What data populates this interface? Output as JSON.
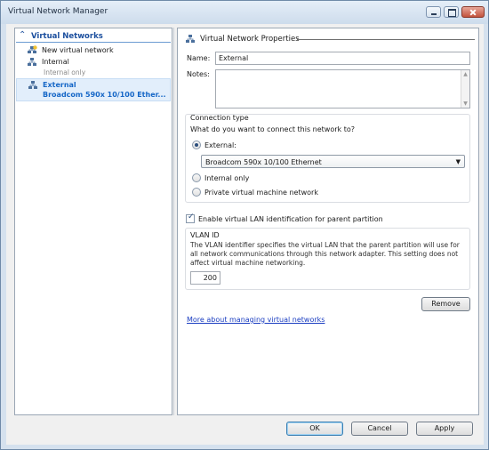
{
  "window": {
    "title": "Virtual Network Manager"
  },
  "tree": {
    "header": "Virtual Networks",
    "items": [
      {
        "label": "New virtual network",
        "icon": "new-network-icon"
      },
      {
        "label": "Internal",
        "sublabel": "Internal only",
        "icon": "network-icon"
      },
      {
        "label": "External",
        "sublabel": "Broadcom 590x 10/100 Ether...",
        "icon": "network-icon",
        "selected": true
      }
    ]
  },
  "properties": {
    "section_title": "Virtual Network Properties",
    "name_label": "Name:",
    "name_value": "External",
    "notes_label": "Notes:",
    "notes_value": ""
  },
  "connection": {
    "group_title": "Connection type",
    "question": "What do you want to connect this network to?",
    "options": [
      {
        "label": "External:",
        "checked": true
      },
      {
        "label": "Internal only",
        "checked": false
      },
      {
        "label": "Private virtual machine network",
        "checked": false
      }
    ],
    "adapter_selected": "Broadcom 590x 10/100 Ethernet"
  },
  "vlan": {
    "checkbox_label": "Enable virtual LAN identification for parent partition",
    "checked": true,
    "group_title": "VLAN ID",
    "description": "The VLAN identifier specifies the virtual LAN that the parent partition will use for all network communications through this network adapter. This setting does not affect virtual machine networking.",
    "value": "200"
  },
  "actions": {
    "remove_label": "Remove",
    "more_link": "More about managing virtual networks"
  },
  "footer": {
    "ok_label": "OK",
    "cancel_label": "Cancel",
    "apply_label": "Apply"
  },
  "colors": {
    "accent": "#1c4f9e",
    "selection": "#e2eefb",
    "link": "#1a3dc1"
  }
}
